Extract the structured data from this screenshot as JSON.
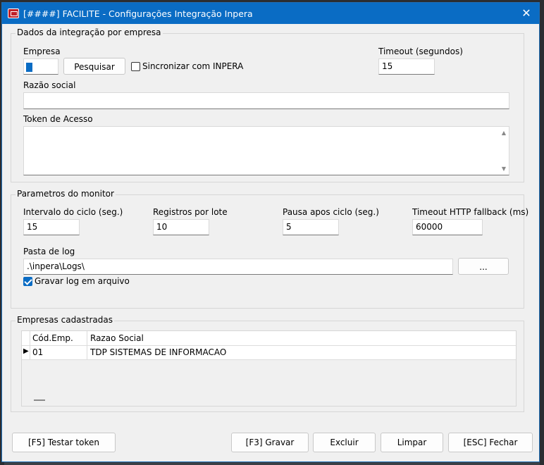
{
  "window": {
    "title": "[####] FACILITE - Configurações Integração Inpera",
    "close_glyph": "✕"
  },
  "dados": {
    "legend": "Dados da integração por empresa",
    "empresa_label": "Empresa",
    "empresa_value": "",
    "pesquisar_label": "Pesquisar",
    "sincronizar_label": "Sincronizar com INPERA",
    "sincronizar_checked": false,
    "timeout_label": "Timeout (segundos)",
    "timeout_value": "15",
    "razao_label": "Razão social",
    "razao_value": "",
    "token_label": "Token de Acesso",
    "token_value": ""
  },
  "monitor": {
    "legend": "Parametros do monitor",
    "intervalo_label": "Intervalo do ciclo (seg.)",
    "intervalo_value": "15",
    "registros_label": "Registros por lote",
    "registros_value": "10",
    "pausa_label": "Pausa apos ciclo (seg.)",
    "pausa_value": "5",
    "timeout_http_label": "Timeout HTTP fallback (ms)",
    "timeout_http_value": "60000",
    "pasta_label": "Pasta de log",
    "pasta_value": ".\\inpera\\Logs\\",
    "browse_label": "...",
    "gravar_log_label": "Gravar log em arquivo",
    "gravar_log_checked": true
  },
  "empresas": {
    "legend": "Empresas cadastradas",
    "columns": [
      "Cód.Emp.",
      "Razao Social"
    ],
    "rows": [
      {
        "cod": "01",
        "razao": "TDP SISTEMAS DE INFORMACAO"
      }
    ]
  },
  "footer": {
    "testar_label": "[F5] Testar token",
    "gravar_label": "[F3] Gravar",
    "excluir_label": "Excluir",
    "limpar_label": "Limpar",
    "fechar_label": "[ESC] Fechar"
  },
  "colors": {
    "titlebar": "#0a6cc4",
    "window_bg": "#f0f0f0",
    "accent": "#0a6cc4"
  }
}
